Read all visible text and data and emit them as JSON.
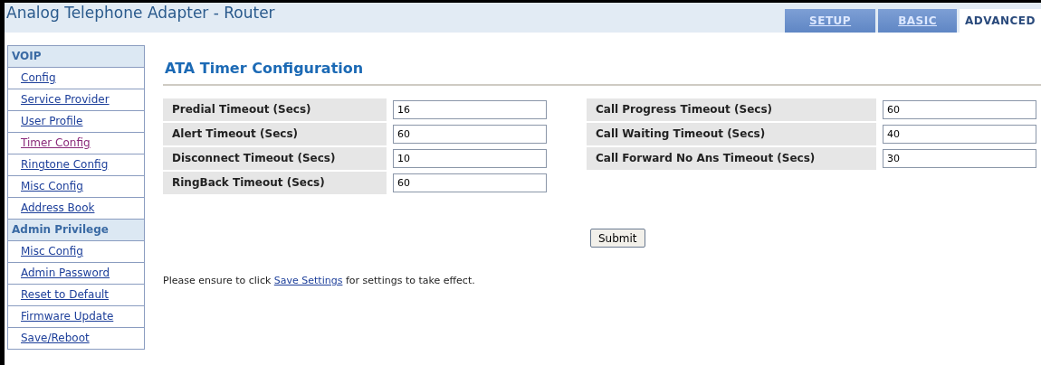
{
  "header": {
    "title": "Analog Telephone Adapter - Router"
  },
  "tabs": [
    {
      "label": "SETUP",
      "selected": false
    },
    {
      "label": "BASIC",
      "selected": false
    },
    {
      "label": "ADVANCED",
      "selected": true
    }
  ],
  "sidebar": {
    "sections": [
      {
        "heading": "VOIP",
        "items": [
          {
            "label": "Config",
            "selected": false
          },
          {
            "label": "Service Provider",
            "selected": false
          },
          {
            "label": "User Profile",
            "selected": false
          },
          {
            "label": "Timer Config",
            "selected": true
          },
          {
            "label": "Ringtone Config",
            "selected": false
          },
          {
            "label": "Misc Config",
            "selected": false
          },
          {
            "label": "Address Book",
            "selected": false
          }
        ]
      },
      {
        "heading": "Admin Privilege",
        "items": [
          {
            "label": "Misc Config",
            "selected": false
          },
          {
            "label": "Admin Password",
            "selected": false
          },
          {
            "label": "Reset to Default",
            "selected": false
          },
          {
            "label": "Firmware Update",
            "selected": false
          },
          {
            "label": "Save/Reboot",
            "selected": false
          }
        ]
      }
    ]
  },
  "page_title": "ATA Timer Configuration",
  "fields_left": [
    {
      "label": "Predial Timeout (Secs)",
      "value": "16"
    },
    {
      "label": "Alert Timeout (Secs)",
      "value": "60"
    },
    {
      "label": "Disconnect Timeout (Secs)",
      "value": "10"
    },
    {
      "label": "RingBack Timeout (Secs)",
      "value": "60"
    }
  ],
  "fields_right": [
    {
      "label": "Call Progress Timeout (Secs)",
      "value": "60"
    },
    {
      "label": "Call Waiting Timeout (Secs)",
      "value": "40"
    },
    {
      "label": "Call Forward No Ans Timeout (Secs)",
      "value": "30"
    }
  ],
  "submit_button": "Submit",
  "note": {
    "before": "Please ensure to click ",
    "link": "Save Settings",
    "after": " for settings to take effect."
  }
}
